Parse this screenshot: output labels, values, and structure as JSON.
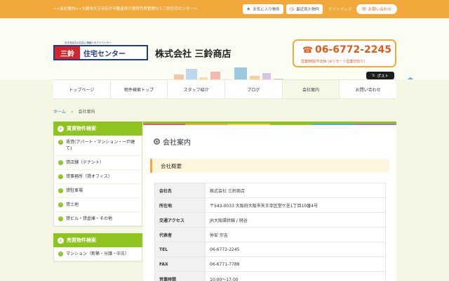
{
  "topbar": {
    "tagline": "<<会社案内>>大阪市天王寺区の不動産仲介賃貸売買管理なら三鈴住宅センターへ",
    "favorites": "お気に入り物件",
    "recent": "最近見た物件",
    "sitemap": "サイトマップ",
    "contact": "お問い合わせ"
  },
  "header": {
    "logo_red": "三鈴",
    "logo_blue": "住宅センター",
    "logo_sub": "天王寺区中心住まい情報へのアドバイザー",
    "company_name": "株式会社 三鈴商店",
    "phone": "06-6772-2245",
    "hours": "営業時間/不定休 (※リモート営業日有り)",
    "tw_post": "ポスト"
  },
  "nav": [
    "トップページ",
    "物件検索トップ",
    "スタッフ紹介",
    "ブログ",
    "会社案内",
    "お問い合わせ"
  ],
  "breadcrumb": {
    "home": "ホーム",
    "sep": "»",
    "current": "会社案内"
  },
  "sidebar": {
    "rent_title": "賃貸物件検索",
    "rent_items": [
      "賃貸(アパート・マンション・一戸建て)",
      "貸店舗（テナント）",
      "貸事務所（貸オフィス）",
      "貸駐車場",
      "貸土地",
      "貸ビル・貸倉庫・その他"
    ],
    "sale_title": "売買物件検索",
    "sale_items": [
      "マンション（新築・分譲・中古）"
    ]
  },
  "main": {
    "title": "会社案内",
    "section": "会社概要",
    "rows": [
      {
        "label": "会社名",
        "value": "株式会社 三鈴商店"
      },
      {
        "label": "所在地",
        "value": "〒543-0033 大阪府大阪市天王寺区堂ケ芝1丁目10番4号"
      },
      {
        "label": "交通アクセス",
        "value": "JR大阪環状線 / 桃谷"
      },
      {
        "label": "代表者",
        "value": "仲安 宗吉"
      },
      {
        "label": "TEL",
        "value": "06-6772-2245"
      },
      {
        "label": "FAX",
        "value": "06-6771-7788"
      },
      {
        "label": "営業時間",
        "value": "10:00～17:00"
      }
    ]
  },
  "colors": {
    "accent": "#8fc31f",
    "topbar": "#f2a93b",
    "phone": "#e45a14",
    "link": "#2d7cbf"
  }
}
